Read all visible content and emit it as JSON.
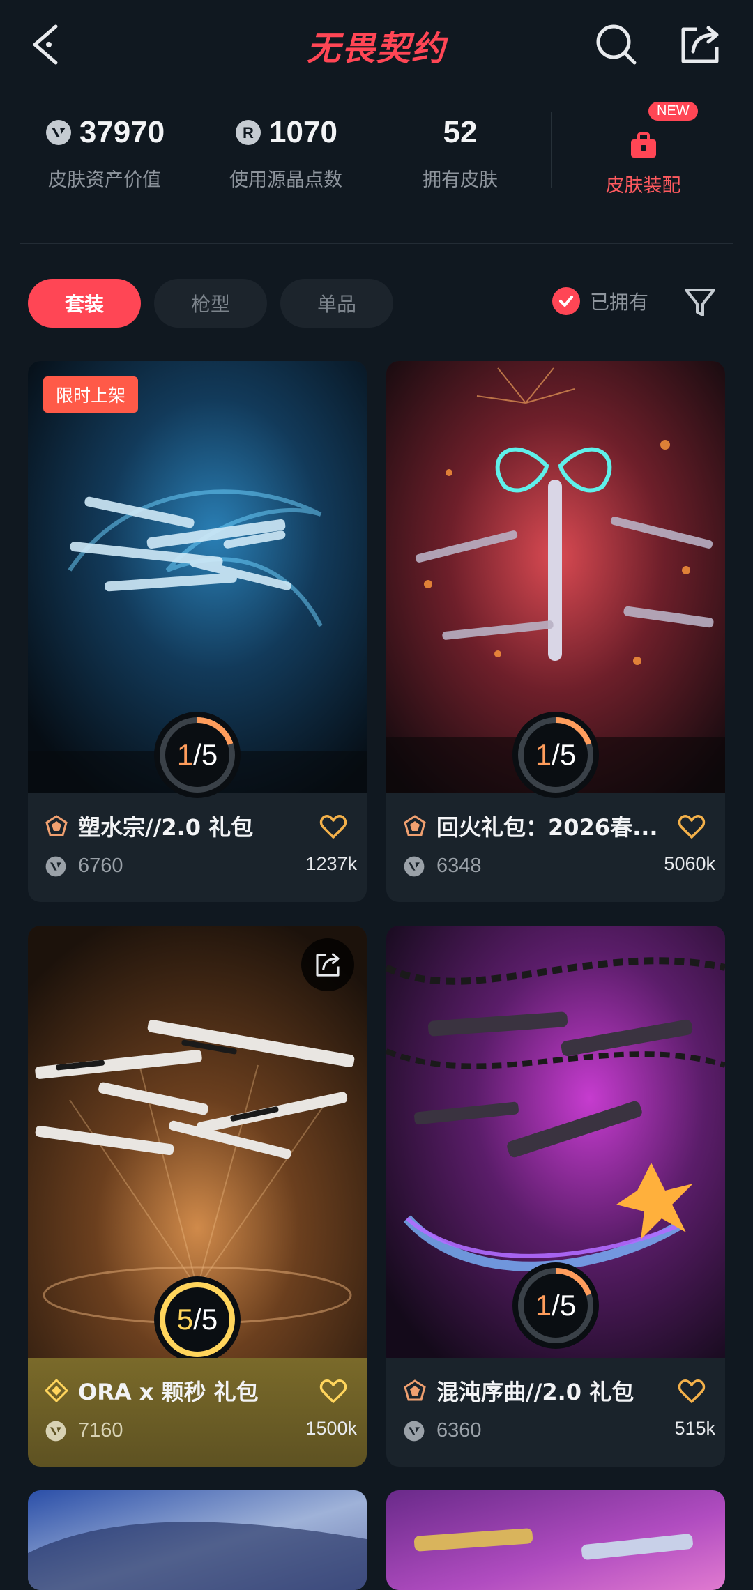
{
  "header": {
    "title": "无畏契约"
  },
  "stats": {
    "asset_value": "37970",
    "asset_value_label": "皮肤资产价值",
    "radianite": "1070",
    "radianite_label": "使用源晶点数",
    "owned_skins": "52",
    "owned_skins_label": "拥有皮肤",
    "loadout_label": "皮肤装配",
    "new_badge": "NEW"
  },
  "tabs": {
    "bundle": "套装",
    "weapon_type": "枪型",
    "single": "单品",
    "owned_filter": "已拥有"
  },
  "cards": [
    {
      "name": "塑水宗//2.0 礼包",
      "price": "6760",
      "likes": "1237k",
      "progress_owned": "1",
      "progress_total": "/5",
      "badge": "限时上架"
    },
    {
      "name": "回火礼包：2026春...",
      "price": "6348",
      "likes": "5060k",
      "progress_owned": "1",
      "progress_total": "/5"
    },
    {
      "name": "ORA x 颗秒 礼包",
      "price": "7160",
      "likes": "1500k",
      "progress_owned": "5",
      "progress_total": "/5"
    },
    {
      "name": "混沌序曲//2.0 礼包",
      "price": "6360",
      "likes": "515k",
      "progress_owned": "1",
      "progress_total": "/5"
    }
  ],
  "colors": {
    "accent": "#ff4655",
    "background": "#101820",
    "card": "#1a232b",
    "progress_arc": "#ff9d5c",
    "gold": "#ffd55c"
  }
}
